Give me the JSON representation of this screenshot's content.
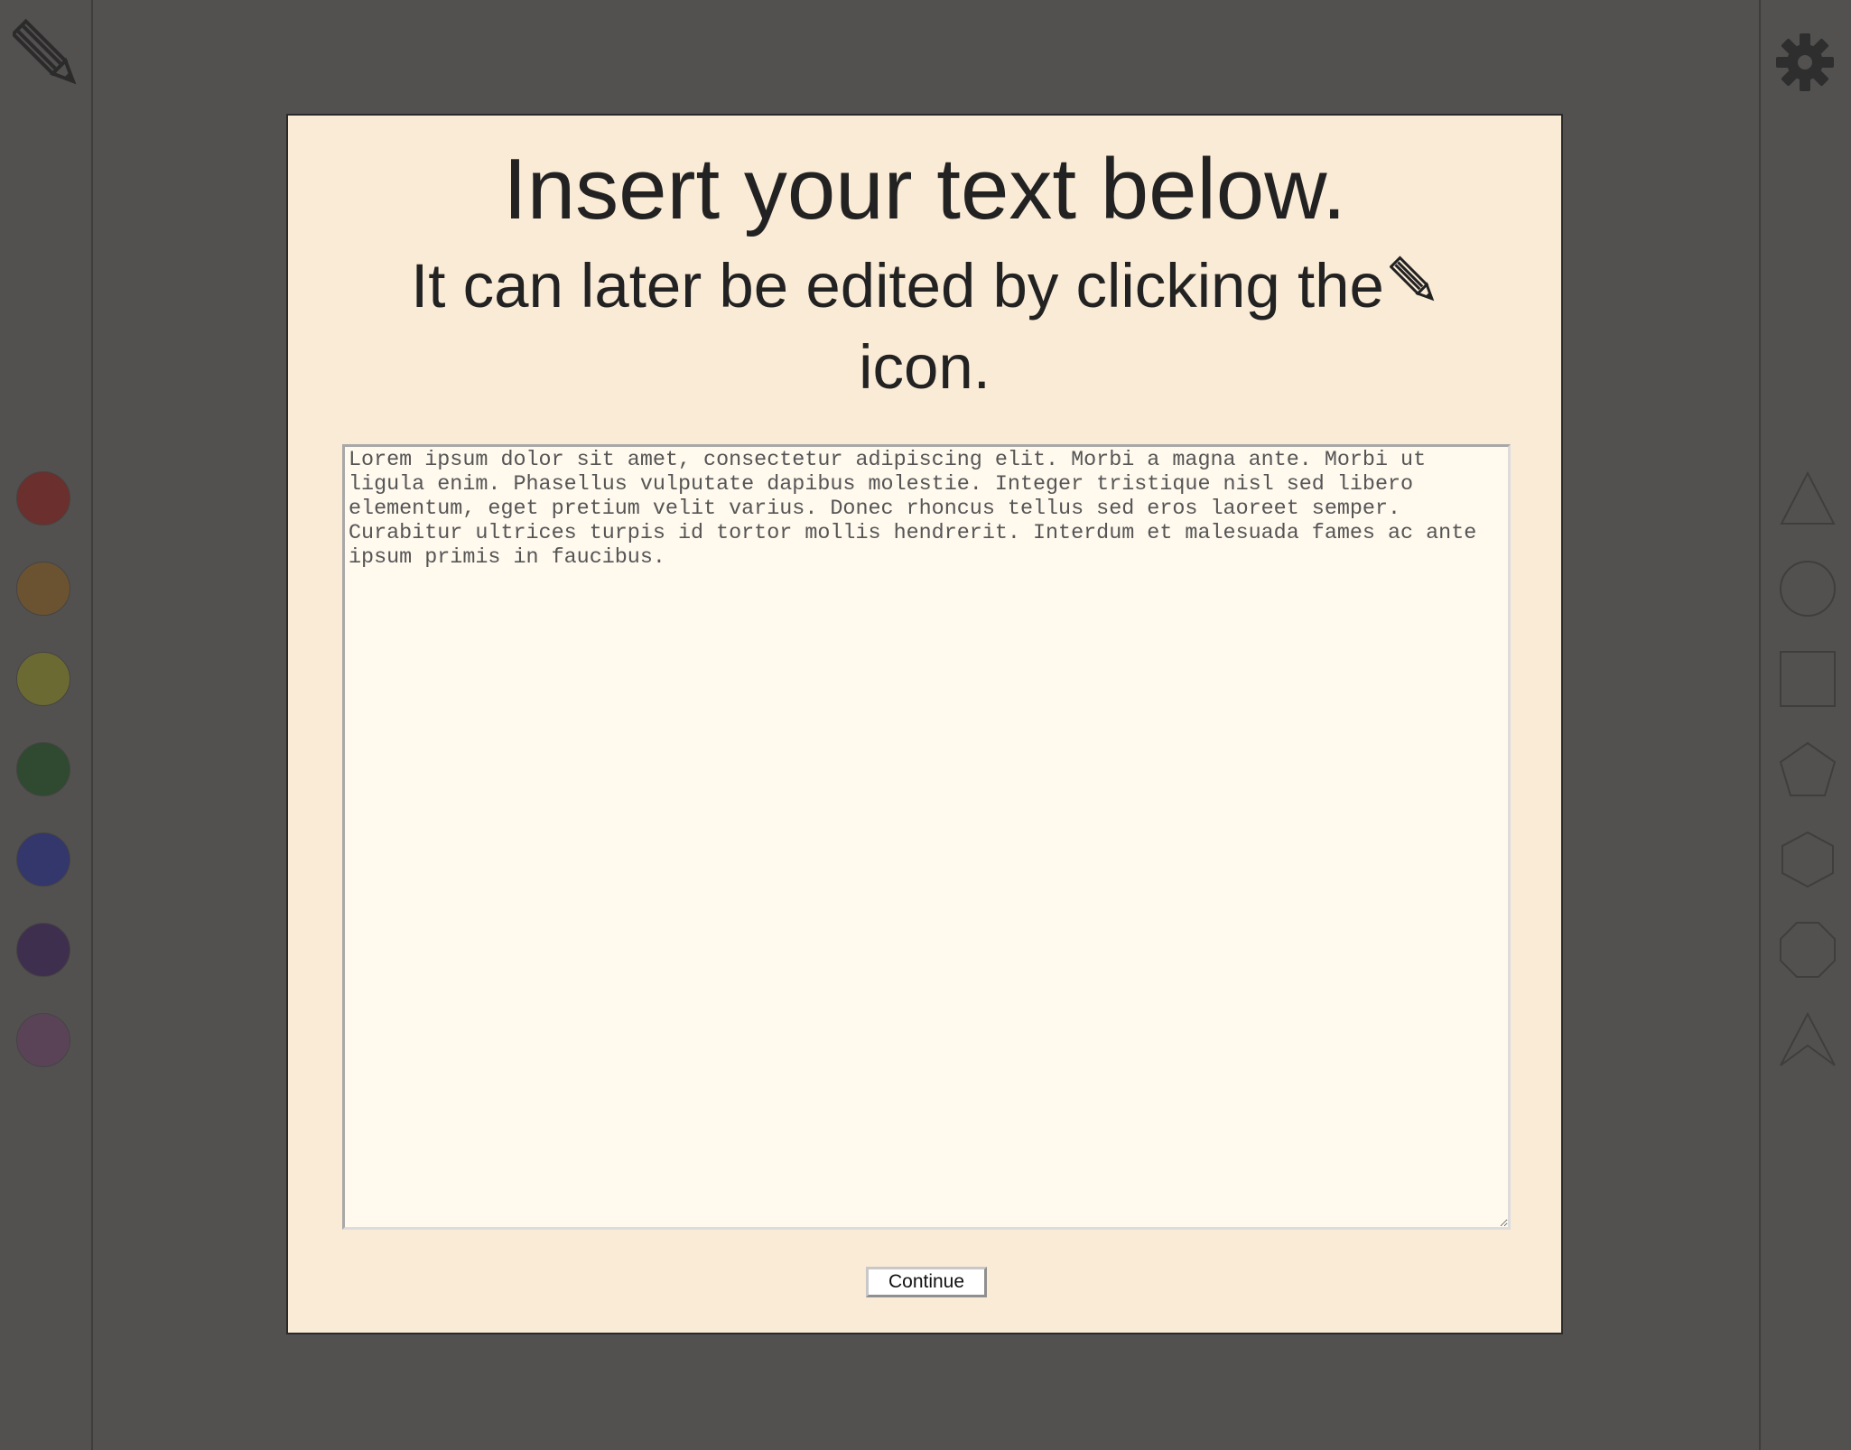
{
  "modal": {
    "title": "Insert your text below.",
    "subtitle_text": "It can later be edited by clicking the",
    "subtitle_end": "icon.",
    "textarea_value": "Lorem ipsum dolor sit amet, consectetur adipiscing elit. Morbi a magna ante. Morbi ut ligula enim. Phasellus vulputate dapibus molestie. Integer tristique nisl sed libero elementum, eget pretium velit varius. Donec rhoncus tellus sed eros laoreet semper. Curabitur ultrices turpis id tortor mollis hendrerit. Interdum et malesuada fames ac ante ipsum primis in faucibus.",
    "continue_label": "Continue"
  },
  "left_toolbar": {
    "tool_icon": "pencil-icon",
    "swatches": [
      {
        "name": "red",
        "color": "#6b2f2d"
      },
      {
        "name": "brown",
        "color": "#6b5331"
      },
      {
        "name": "olive",
        "color": "#6c6a33"
      },
      {
        "name": "green",
        "color": "#2f4a30"
      },
      {
        "name": "blue",
        "color": "#33376b"
      },
      {
        "name": "purple",
        "color": "#3f2f4e"
      },
      {
        "name": "mauve",
        "color": "#5a4357"
      }
    ]
  },
  "right_toolbar": {
    "settings_icon": "gear-icon",
    "shapes": [
      "triangle",
      "circle",
      "square",
      "pentagon",
      "hexagon",
      "octagon",
      "arrow"
    ]
  },
  "colors": {
    "background": "#525150",
    "modal_background": "#faebd7",
    "textarea_background": "#fff9ee",
    "text": "#222222"
  }
}
